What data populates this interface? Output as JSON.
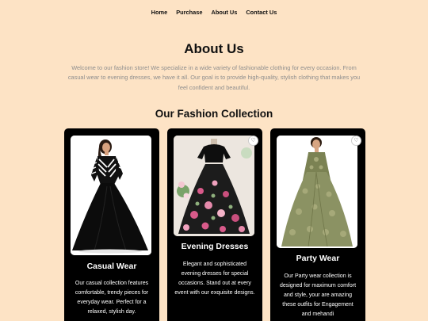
{
  "nav": {
    "items": [
      {
        "label": "Home"
      },
      {
        "label": "Purchase"
      },
      {
        "label": "About Us"
      },
      {
        "label": "Contact Us"
      }
    ]
  },
  "about": {
    "title": "About Us",
    "text": "Welcome to our fashion store! We specialize in a wide variety of fashionable clothing for every occasion. From casual wear to evening dresses, we have it all. Our goal is to provide high-quality, stylish clothing that makes you feel confident and beautiful."
  },
  "collection": {
    "title": "Our Fashion Collection",
    "cards": [
      {
        "title": "Casual Wear",
        "description": "Our casual collection features comfortable, trendy pieces for everyday wear. Perfect for a relaxed, stylish day.",
        "icon": "heart-icon"
      },
      {
        "title": "Evening Dresses",
        "description": "Elegant and sophisticated evening dresses for special occasions. Stand out at every event with our exquisite designs.",
        "icon": "heart-icon"
      },
      {
        "title": "Party Wear",
        "description": "Our Party wear collection is designed for maximum comfort and style, your are amazing these outfits for Engagement and mehandi",
        "icon": "heart-icon"
      }
    ]
  },
  "colors": {
    "background": "#fde3c5",
    "card": "#000000",
    "muted_text": "#8e8e8e"
  }
}
